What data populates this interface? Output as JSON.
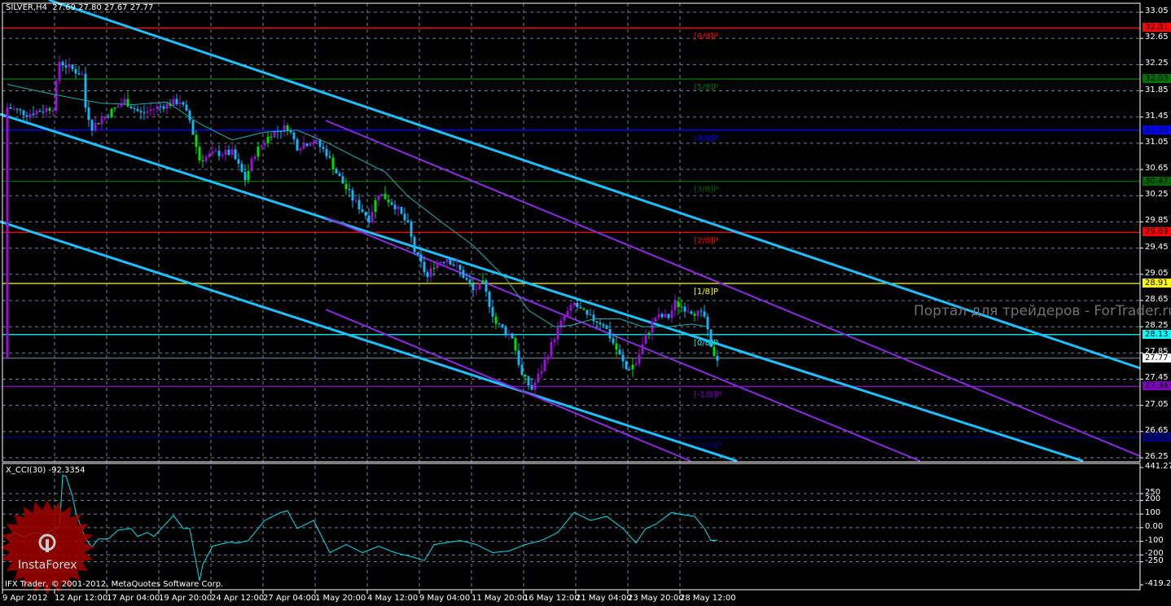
{
  "header": {
    "symbol": "SILVER,H4",
    "ohlc": "27.69 27.80 27.67 27.77"
  },
  "watermark": "Портал для трейдеров - ForTrader.ru",
  "logo": "InstaForex",
  "copyright": "IFX Trader, © 2001-2012, MetaQuotes Software Corp.",
  "colors": {
    "channel": "#1ec0ff",
    "purple_channel": "#8a2be2",
    "ma": "#20b0b0",
    "cci": "#00e0f0",
    "bull": "#9a10d8",
    "bear": "#18b4f4",
    "grid": "#6e8296"
  },
  "chart_data": [
    {
      "type": "candlestick",
      "title": "SILVER,H4",
      "ylim": [
        26.25,
        33.05
      ],
      "y_ticks": [
        "33.05",
        "32.65",
        "32.25",
        "31.85",
        "31.45",
        "31.05",
        "30.65",
        "30.25",
        "29.85",
        "29.45",
        "29.05",
        "28.65",
        "28.25",
        "27.85",
        "27.45",
        "27.05",
        "26.65",
        "26.25"
      ],
      "x_ticks": [
        "9 Apr 2012",
        "12 Apr 12:00",
        "17 Apr 04:00",
        "19 Apr 20:00",
        "24 Apr 12:00",
        "27 Apr 04:00",
        "1 May 20:00",
        "4 May 12:00",
        "9 May 04:00",
        "11 May 20:00",
        "16 May 12:00",
        "21 May 04:00",
        "23 May 20:00",
        "28 May 12:00"
      ],
      "bars_per_tick": 16,
      "close_waypoints": [
        [
          1,
          31.6
        ],
        [
          7,
          31.5
        ],
        [
          15,
          31.6
        ],
        [
          17,
          32.3
        ],
        [
          20,
          32.2
        ],
        [
          24,
          32.1
        ],
        [
          25,
          31.6
        ],
        [
          27,
          31.3
        ],
        [
          32,
          31.5
        ],
        [
          37,
          31.7
        ],
        [
          42,
          31.5
        ],
        [
          47,
          31.6
        ],
        [
          54,
          31.7
        ],
        [
          57,
          31.4
        ],
        [
          60,
          30.8
        ],
        [
          65,
          30.9
        ],
        [
          70,
          30.9
        ],
        [
          74,
          30.5
        ],
        [
          77,
          30.9
        ],
        [
          82,
          31.2
        ],
        [
          87,
          31.3
        ],
        [
          90,
          31.0
        ],
        [
          95,
          31.1
        ],
        [
          99,
          30.9
        ],
        [
          102,
          30.6
        ],
        [
          107,
          30.2
        ],
        [
          112,
          29.9
        ],
        [
          115,
          30.3
        ],
        [
          120,
          30.1
        ],
        [
          124,
          29.8
        ],
        [
          126,
          29.4
        ],
        [
          130,
          29.0
        ],
        [
          132,
          29.2
        ],
        [
          136,
          29.3
        ],
        [
          140,
          29.1
        ],
        [
          144,
          28.8
        ],
        [
          147,
          28.9
        ],
        [
          151,
          28.3
        ],
        [
          156,
          28.1
        ],
        [
          159,
          27.5
        ],
        [
          162,
          27.3
        ],
        [
          165,
          27.6
        ],
        [
          169,
          28.1
        ],
        [
          172,
          28.4
        ],
        [
          175,
          28.6
        ],
        [
          179,
          28.4
        ],
        [
          184,
          28.3
        ],
        [
          187,
          28.0
        ],
        [
          191,
          27.6
        ],
        [
          194,
          27.7
        ],
        [
          197,
          28.1
        ],
        [
          200,
          28.4
        ],
        [
          204,
          28.4
        ],
        [
          206,
          28.6
        ],
        [
          211,
          28.5
        ],
        [
          215,
          28.4
        ],
        [
          217,
          27.9
        ],
        [
          219,
          27.77
        ]
      ],
      "ma_waypoints": [
        [
          1,
          31.95
        ],
        [
          10,
          31.85
        ],
        [
          20,
          31.75
        ],
        [
          30,
          31.66
        ],
        [
          40,
          31.64
        ],
        [
          50,
          31.68
        ],
        [
          60,
          31.35
        ],
        [
          70,
          31.1
        ],
        [
          80,
          31.22
        ],
        [
          90,
          31.25
        ],
        [
          100,
          31.04
        ],
        [
          107,
          30.86
        ],
        [
          117,
          30.61
        ],
        [
          124,
          30.24
        ],
        [
          134,
          29.86
        ],
        [
          144,
          29.49
        ],
        [
          154,
          28.99
        ],
        [
          161,
          28.5
        ],
        [
          169,
          28.25
        ],
        [
          174,
          28.27
        ],
        [
          181,
          28.37
        ],
        [
          189,
          28.37
        ],
        [
          196,
          28.25
        ],
        [
          204,
          28.25
        ],
        [
          211,
          28.29
        ],
        [
          216,
          28.25
        ]
      ],
      "murrey_levels": [
        {
          "label": "[6/8]P",
          "value": 32.81,
          "price_label": "32.81",
          "color": "#ff0000"
        },
        {
          "label": "[5/8]P",
          "value": 32.03,
          "price_label": "32.03",
          "color": "#007000"
        },
        {
          "label": "[4/8]P",
          "value": 31.25,
          "price_label": "31.25",
          "color": "#0000ff"
        },
        {
          "label": "[3/8]P",
          "value": 30.47,
          "price_label": "30.47",
          "color": "#006400"
        },
        {
          "label": "[2/8]P",
          "value": 29.69,
          "price_label": "29.69",
          "color": "#ff0000"
        },
        {
          "label": "[1/8]P",
          "value": 28.91,
          "price_label": "28.91",
          "color": "#ffff00"
        },
        {
          "label": "[0/8]P",
          "value": 28.13,
          "price_label": "28.13",
          "color": "#00ffff"
        },
        {
          "label": "[-1/8]P",
          "value": 27.34,
          "price_label": "27.34",
          "color": "#8000c0"
        },
        {
          "label": "[-2/8]P",
          "value": 26.56,
          "price_label": "26.56",
          "color": "#000080"
        }
      ],
      "current_price": {
        "value": 27.77,
        "label": "27.77"
      }
    },
    {
      "type": "line",
      "title": "X_CCI(30) -92.3354",
      "ylim": [
        -419.246,
        441.274
      ],
      "y_ticks": [
        "441.274",
        "250",
        "200",
        "100",
        "0.00",
        "-100",
        "-200",
        "-250",
        "-419.246"
      ],
      "y_tick_values": [
        441.274,
        250,
        200,
        100,
        0,
        -100,
        -200,
        -250,
        -419.246
      ],
      "waypoints": [
        [
          1,
          -77
        ],
        [
          3,
          -35
        ],
        [
          6,
          -65
        ],
        [
          10,
          -35
        ],
        [
          12,
          -53
        ],
        [
          17,
          6
        ],
        [
          18,
          384
        ],
        [
          19,
          378
        ],
        [
          21,
          230
        ],
        [
          22,
          112
        ],
        [
          25,
          -83
        ],
        [
          27,
          -142
        ],
        [
          29,
          -83
        ],
        [
          32,
          -83
        ],
        [
          35,
          -18
        ],
        [
          39,
          -6
        ],
        [
          41,
          -65
        ],
        [
          44,
          -35
        ],
        [
          46,
          -65
        ],
        [
          49,
          12
        ],
        [
          52,
          89
        ],
        [
          55,
          -6
        ],
        [
          57,
          -6
        ],
        [
          60,
          -389
        ],
        [
          61,
          -271
        ],
        [
          64,
          -136
        ],
        [
          66,
          -124
        ],
        [
          69,
          -106
        ],
        [
          72,
          -112
        ],
        [
          75,
          -94
        ],
        [
          80,
          53
        ],
        [
          85,
          112
        ],
        [
          87,
          124
        ],
        [
          90,
          -6
        ],
        [
          95,
          53
        ],
        [
          100,
          -183
        ],
        [
          105,
          -124
        ],
        [
          110,
          -183
        ],
        [
          115,
          -136
        ],
        [
          120,
          -183
        ],
        [
          125,
          -212
        ],
        [
          129,
          -242
        ],
        [
          132,
          -124
        ],
        [
          140,
          -94
        ],
        [
          145,
          -124
        ],
        [
          150,
          -183
        ],
        [
          155,
          -171
        ],
        [
          160,
          -124
        ],
        [
          165,
          -94
        ],
        [
          170,
          -35
        ],
        [
          175,
          112
        ],
        [
          180,
          53
        ],
        [
          185,
          83
        ],
        [
          190,
          -6
        ],
        [
          194,
          -112
        ],
        [
          197,
          -6
        ],
        [
          200,
          24
        ],
        [
          205,
          112
        ],
        [
          207,
          100
        ],
        [
          212,
          83
        ],
        [
          215,
          -6
        ],
        [
          217,
          -94
        ],
        [
          219,
          -92
        ]
      ]
    }
  ]
}
